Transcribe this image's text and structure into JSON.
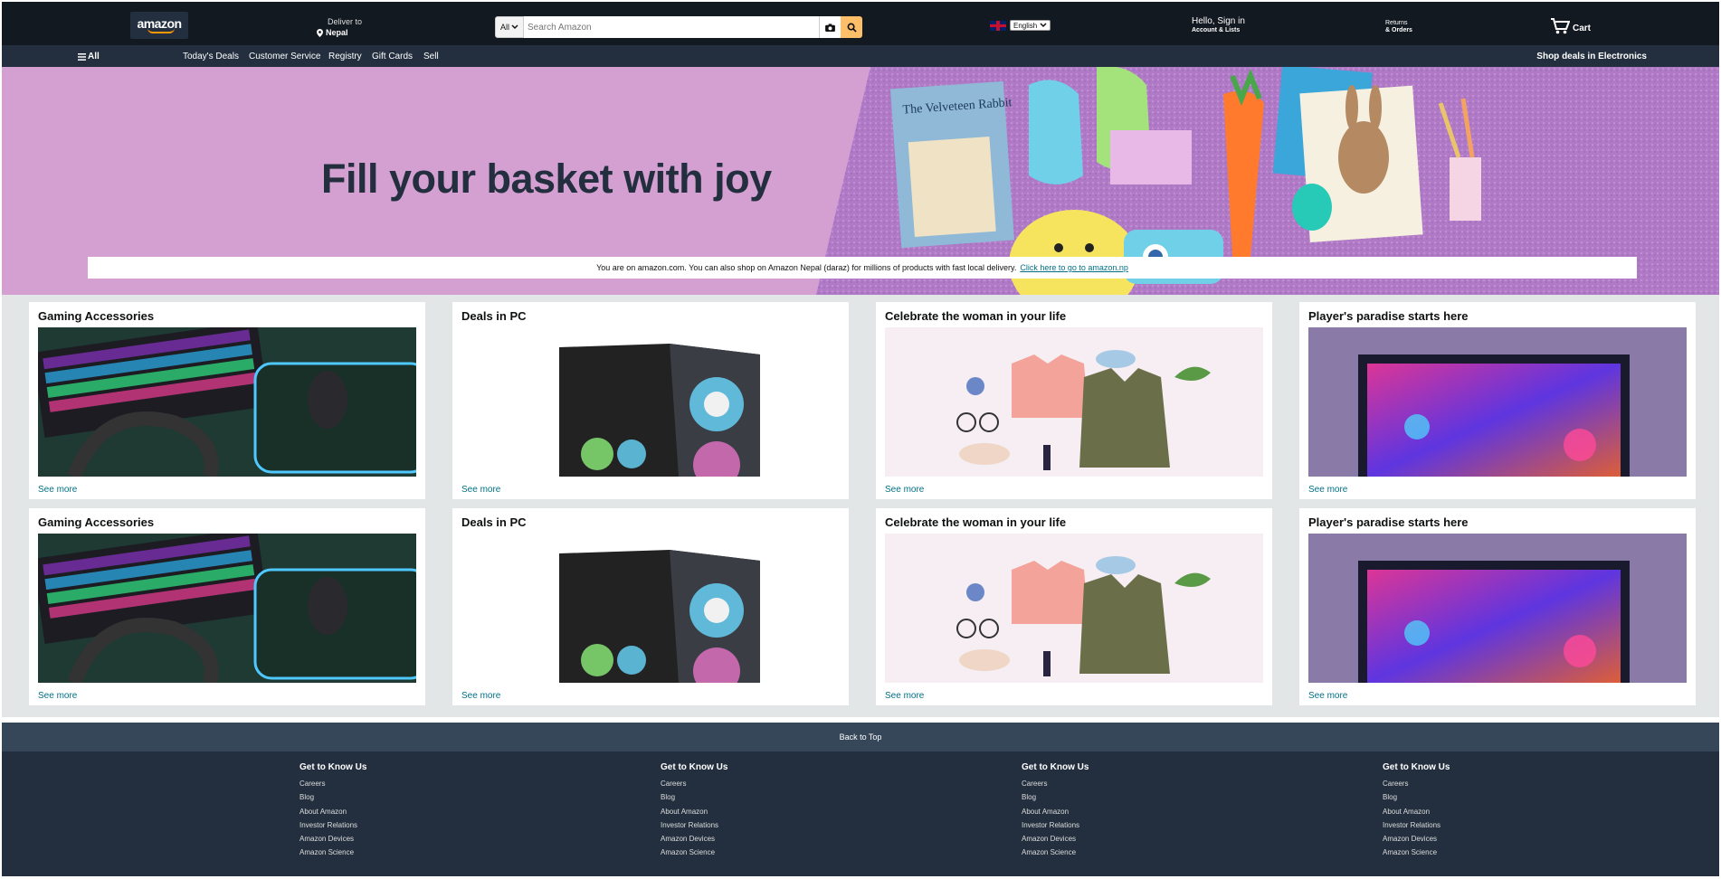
{
  "header": {
    "logo_text": "amazon",
    "deliver_line1": "Deliver to",
    "deliver_location": "Nepal",
    "search_category": "All",
    "search_placeholder": "Search Amazon",
    "language": "English",
    "account_line1": "Hello, Sign in",
    "account_line2": "Account & Lists",
    "returns_line1": "Returns",
    "returns_line2": "& Orders",
    "cart_label": "Cart"
  },
  "subnav": {
    "all_label": "All",
    "items": [
      "Today's Deals",
      "Customer Service",
      "Registry",
      "Gift Cards",
      "Sell"
    ],
    "promo": "Shop deals in Electronics"
  },
  "hero": {
    "title": "Fill your basket with joy",
    "book_title": "The Velveteen Rabbit",
    "notice_text": "You are on amazon.com. You can also shop on Amazon Nepal (daraz) for millions of products with fast local delivery.",
    "notice_link": "Click here to go to amazon.np"
  },
  "cards": [
    {
      "title": "Gaming Accessories",
      "link": "See more"
    },
    {
      "title": "Deals in PC",
      "link": "See more"
    },
    {
      "title": "Celebrate the woman in your life",
      "link": "See more"
    },
    {
      "title": "Player's paradise starts here",
      "link": "See more"
    },
    {
      "title": "Gaming Accessories",
      "link": "See more"
    },
    {
      "title": "Deals in PC",
      "link": "See more"
    },
    {
      "title": "Celebrate the woman in your life",
      "link": "See more"
    },
    {
      "title": "Player's paradise starts here",
      "link": "See more"
    }
  ],
  "footer": {
    "back_to_top": "Back to Top",
    "columns": [
      {
        "title": "Get to Know Us",
        "links": [
          "Careers",
          "Blog",
          "About Amazon",
          "Investor Relations",
          "Amazon Devices",
          "Amazon Science"
        ]
      },
      {
        "title": "Get to Know Us",
        "links": [
          "Careers",
          "Blog",
          "About Amazon",
          "Investor Relations",
          "Amazon Devices",
          "Amazon Science"
        ]
      },
      {
        "title": "Get to Know Us",
        "links": [
          "Careers",
          "Blog",
          "About Amazon",
          "Investor Relations",
          "Amazon Devices",
          "Amazon Science"
        ]
      },
      {
        "title": "Get to Know Us",
        "links": [
          "Careers",
          "Blog",
          "About Amazon",
          "Investor Relations",
          "Amazon Devices",
          "Amazon Science"
        ]
      }
    ]
  },
  "colors": {
    "nav_bg": "#131921",
    "subnav_bg": "#232f3e",
    "accent": "#febd69",
    "link": "#007185",
    "hero_bg": "#d4a0d2",
    "backtop_bg": "#37475a"
  }
}
